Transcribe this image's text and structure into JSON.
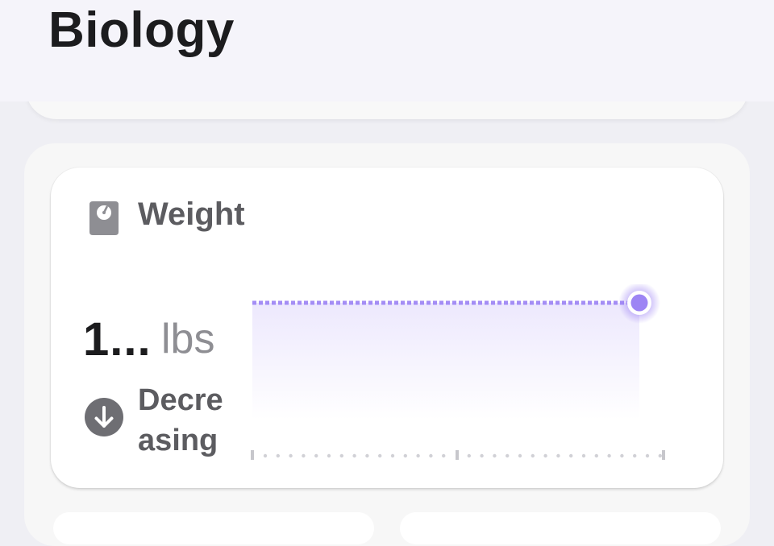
{
  "header": {
    "title": "Biology"
  },
  "weight_card": {
    "title": "Weight",
    "icon": "scale-icon",
    "value": "1...",
    "unit": "lbs",
    "trend": {
      "label": "Decreasing",
      "icon": "arrow-down-circle-icon"
    }
  },
  "colors": {
    "accent": "#9d85f4",
    "title_text": "#1c1c1e",
    "secondary_text": "#5c5c60",
    "unit_text": "#8e8e93",
    "page_bg": "#efeff4"
  }
}
